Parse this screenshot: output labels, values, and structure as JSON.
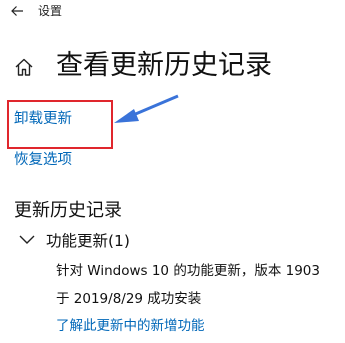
{
  "window": {
    "title": "设置"
  },
  "page": {
    "title": "查看更新历史记录"
  },
  "links": {
    "uninstall": "卸载更新",
    "recovery": "恢复选项"
  },
  "history": {
    "section_title": "更新历史记录",
    "group": {
      "label": "功能更新(1)",
      "items": [
        {
          "name": "针对 Windows 10 的功能更新，版本 1903",
          "status": "于 2019/8/29 成功安装",
          "link": "了解此更新中的新增功能"
        }
      ]
    }
  },
  "icons": {
    "back": "back-arrow-icon",
    "home": "home-icon",
    "chevron": "chevron-down-icon"
  },
  "colors": {
    "link": "#0067b8",
    "highlight_box": "#e0262d",
    "annotation_arrow": "#3a73d9"
  }
}
